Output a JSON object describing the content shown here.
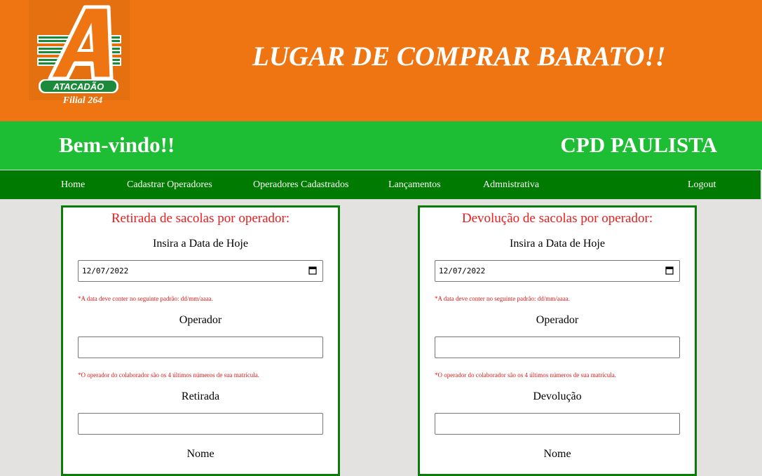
{
  "header": {
    "logo_text": "ATACADÃO",
    "branch": "Filial 264",
    "slogan": "LUGAR DE COMPRAR BARATO!!"
  },
  "greeting": {
    "welcome": "Bem-vindo!!",
    "site": "CPD PAULISTA"
  },
  "nav": {
    "items": [
      "Home",
      "Cadastrar Operadores",
      "Operadores Cadastrados",
      "Lançamentos",
      "Admnistrativa"
    ],
    "logout": "Logout"
  },
  "panels": [
    {
      "title": "Retirada de sacolas por operador:",
      "date_label": "Insira a Data de Hoje",
      "date_value": "12/07/2022",
      "date_hint": "*A data deve conter no seguinte padrão: dd/mm/aaaa.",
      "operator_label": "Operador",
      "operator_value": "",
      "operator_hint": "*O operador do colaborador são os 4 últimos números de sua matrícula.",
      "amount_label": "Retirada",
      "amount_value": "",
      "name_label": "Nome"
    },
    {
      "title": "Devolução de sacolas por operador:",
      "date_label": "Insira a Data de Hoje",
      "date_value": "12/07/2022",
      "date_hint": "*A data deve conter no seguinte padrão: dd/mm/aaaa.",
      "operator_label": "Operador",
      "operator_value": "",
      "operator_hint": "*O operador do colaborador são os 4 últimos números de sua matrícula.",
      "amount_label": "Devolução",
      "amount_value": "",
      "name_label": "Nome"
    }
  ],
  "colors": {
    "header_bg": "#ee7511",
    "green_bar": "#1dbe33",
    "nav_bg": "#007a00",
    "panel_border": "#0a7c0a",
    "title_red": "#ee1c1c"
  },
  "icons": [
    "atacadao-logo",
    "calendar-icon"
  ]
}
